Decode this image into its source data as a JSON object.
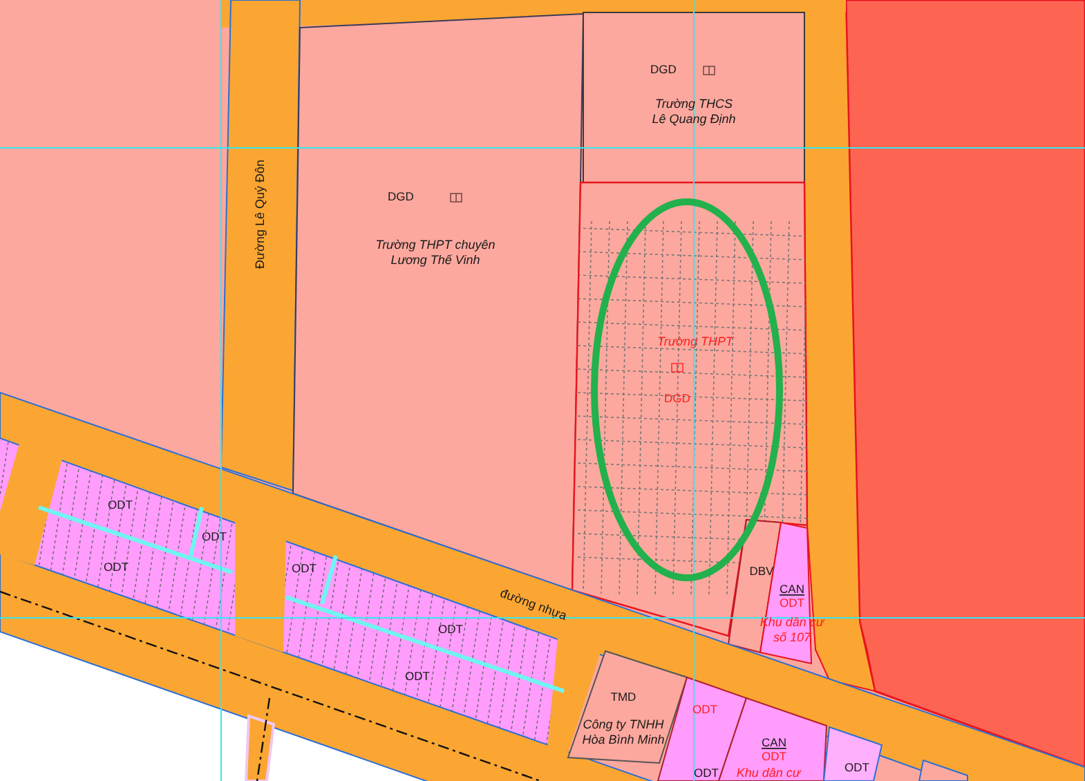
{
  "map": {
    "labels": [
      {
        "kind": "road",
        "lines": [
          "Đường Lê Quý Đôn"
        ]
      },
      {
        "kind": "code",
        "lines": [
          "DGD"
        ]
      },
      {
        "kind": "name",
        "lines": [
          "Trường THPT chuyên",
          "Lương Thế Vinh"
        ]
      },
      {
        "kind": "code",
        "lines": [
          "DGD"
        ]
      },
      {
        "kind": "name",
        "lines": [
          "Trường THCS",
          "Lê Quang Định"
        ]
      },
      {
        "kind": "planned_name",
        "lines": [
          "Trường THPT"
        ]
      },
      {
        "kind": "planned_code",
        "lines": [
          "DGD"
        ]
      },
      {
        "kind": "code",
        "lines": [
          "ODT"
        ]
      },
      {
        "kind": "code",
        "lines": [
          "ODT"
        ]
      },
      {
        "kind": "code",
        "lines": [
          "ODT"
        ]
      },
      {
        "kind": "code",
        "lines": [
          "ODT"
        ]
      },
      {
        "kind": "code",
        "lines": [
          "ODT"
        ]
      },
      {
        "kind": "code",
        "lines": [
          "ODT"
        ]
      },
      {
        "kind": "road",
        "lines": [
          "đường nhựa"
        ]
      },
      {
        "kind": "code",
        "lines": [
          "DBV"
        ]
      },
      {
        "kind": "current_code",
        "lines": [
          "CAN"
        ]
      },
      {
        "kind": "planned_code",
        "lines": [
          "ODT"
        ]
      },
      {
        "kind": "planned_name",
        "lines": [
          "Khu dân cư",
          "số 107"
        ]
      },
      {
        "kind": "code",
        "lines": [
          "TMD"
        ]
      },
      {
        "kind": "name",
        "lines": [
          "Công ty TNHH",
          "Hòa Bình Minh"
        ]
      },
      {
        "kind": "planned_code",
        "lines": [
          "ODT"
        ]
      },
      {
        "kind": "current_code",
        "lines": [
          "CAN"
        ]
      },
      {
        "kind": "planned_code",
        "lines": [
          "ODT"
        ]
      },
      {
        "kind": "code",
        "lines": [
          "ODT"
        ]
      },
      {
        "kind": "code",
        "lines": [
          "ODT"
        ]
      },
      {
        "kind": "planned_name",
        "lines": [
          "Khu dân cư"
        ]
      }
    ]
  }
}
